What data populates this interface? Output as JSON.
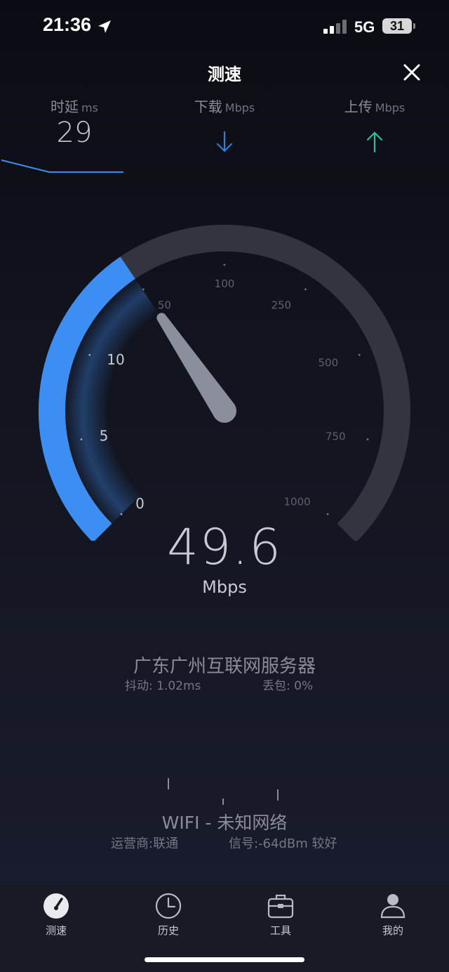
{
  "status_bar": {
    "time": "21:36",
    "network": "5G",
    "battery": "31"
  },
  "header": {
    "title": "测速"
  },
  "metrics": {
    "latency": {
      "label": "时延",
      "unit": "ms",
      "value": "29"
    },
    "download": {
      "label": "下载",
      "unit": "Mbps"
    },
    "upload": {
      "label": "上传",
      "unit": "Mbps"
    }
  },
  "gauge": {
    "value": 49.6,
    "ticks": [
      "0",
      "5",
      "10",
      "50",
      "100",
      "250",
      "500",
      "750",
      "1000"
    ],
    "accent_color": "#3d8ef2"
  },
  "speed": {
    "value": "49.6",
    "unit": "Mbps"
  },
  "server": {
    "name": "广东广州互联网服务器",
    "jitter": "抖动:  1.02ms",
    "packet_loss": "丢包:    0%"
  },
  "network_info": {
    "name": "WIFI - 未知网络",
    "carrier": "运营商:联通",
    "signal": "信号:-64dBm 较好"
  },
  "tabs": [
    {
      "label": "测速",
      "icon": "speedometer-icon"
    },
    {
      "label": "历史",
      "icon": "clock-icon"
    },
    {
      "label": "工具",
      "icon": "toolbox-icon"
    },
    {
      "label": "我的",
      "icon": "user-icon"
    }
  ],
  "colors": {
    "download_arrow": "#2f7fd6",
    "upload_arrow": "#22c59e"
  }
}
